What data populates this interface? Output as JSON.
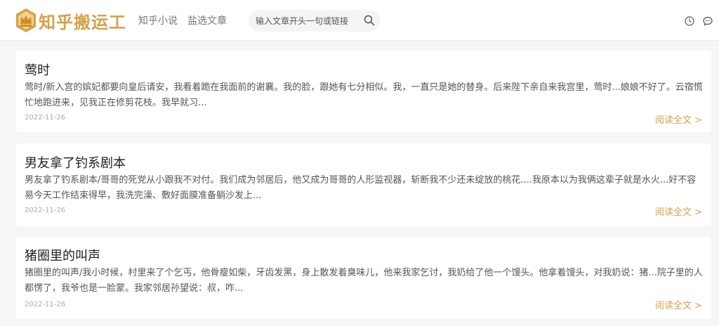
{
  "header": {
    "logo_text": "知乎搬运工",
    "nav": [
      "知乎小说",
      "盐选文章"
    ],
    "search_placeholder": "输入文章开头一句或链接"
  },
  "articles": [
    {
      "title": "莺时",
      "excerpt": "莺时/新入宫的嫔妃都要向皇后请安，我看着跪在我面前的谢襄。我的脸，跟她有七分相似。我，一直只是她的替身。后来陛下亲自来我宫里，莺时...娘娘不好了。云宿慌忙地跑进来，见我正在修剪花枝。我早就习...",
      "date": "2022-11-26",
      "more": "阅读全文 >"
    },
    {
      "title": "男友拿了钓系剧本",
      "excerpt": "男友拿了钓系剧本/哥哥的死党从小跟我不对付。我们成为邻居后，他又成为哥哥的人形监视器，斩断我不少还未绽放的桃花....我原本以为我俩这辈子就是水火...好不容易今天工作结束得早，我洗完澡、敷好面膜准备躺沙发上...",
      "date": "2022-11-26",
      "more": "阅读全文 >"
    },
    {
      "title": "猪圈里的叫声",
      "excerpt": "猪圈里的叫声/我小时候，村里来了个乞丐，他骨瘦如柴，牙齿发黑，身上散发着臭味儿，他来我家乞讨，我奶给了他一个馒头。他拿着馒头，对我奶说：猪...院子里的人都愣了，我爷也是一脸蒙。我家邻居孙望说：叔，咋...",
      "date": "2022-11-26",
      "more": "阅读全文 >"
    }
  ],
  "colors": {
    "accent": "#d4a24a",
    "background": "#f6f6f6",
    "card": "#ffffff"
  },
  "icons": {
    "search": "search-icon",
    "history": "clock-icon",
    "comments": "chat-bubble-icon"
  }
}
